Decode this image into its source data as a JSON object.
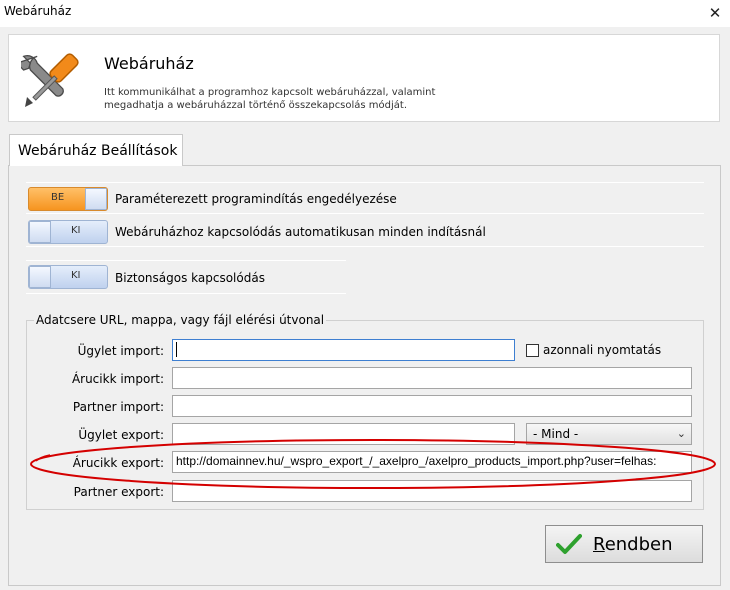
{
  "window": {
    "title": "Webáruház",
    "close_glyph": "✕"
  },
  "header": {
    "title": "Webáruház",
    "description": "Itt kommunikálhat a programhoz kapcsolt webáruházzal, valamint megadhatja a webáruházzal történő összekapcsolás módját.",
    "icon": "tools-icon"
  },
  "tab": {
    "label": "Webáruház Beállítások"
  },
  "toggles": [
    {
      "state": "BE",
      "on": true,
      "label": "Paraméterezett programindítás engedélyezése"
    },
    {
      "state": "KI",
      "on": false,
      "label": "Webáruházhoz kapcsolódás automatikusan minden indításnál"
    },
    {
      "state": "KI",
      "on": false,
      "label": "Biztonságos kapcsolódás"
    }
  ],
  "group": {
    "title": "Adatcsere URL, mappa, vagy fájl elérési útvonal",
    "fields": {
      "ugylet_import": {
        "label": "Ügylet import:",
        "value": ""
      },
      "arucikk_import": {
        "label": "Árucikk import:",
        "value": ""
      },
      "partner_import": {
        "label": "Partner import:",
        "value": ""
      },
      "ugylet_export": {
        "label": "Ügylet export:",
        "value": ""
      },
      "arucikk_export": {
        "label": "Árucikk export:",
        "value": "http://domainnev.hu/_wspro_export_/_axelpro_/axelpro_products_import.php?user=felhas:"
      },
      "partner_export": {
        "label": "Partner export:",
        "value": ""
      }
    },
    "immediate_print": {
      "label": "azonnali nyomtatás",
      "checked": false
    },
    "export_filter": {
      "selected": "- Mind -"
    }
  },
  "ok_button": {
    "label_underlined": "R",
    "label_rest": "endben"
  },
  "colors": {
    "highlight": "#d40000",
    "toggle_on": "#f6941f",
    "toggle_off": "#bfd1ee",
    "ok_check": "#2ea12e"
  }
}
